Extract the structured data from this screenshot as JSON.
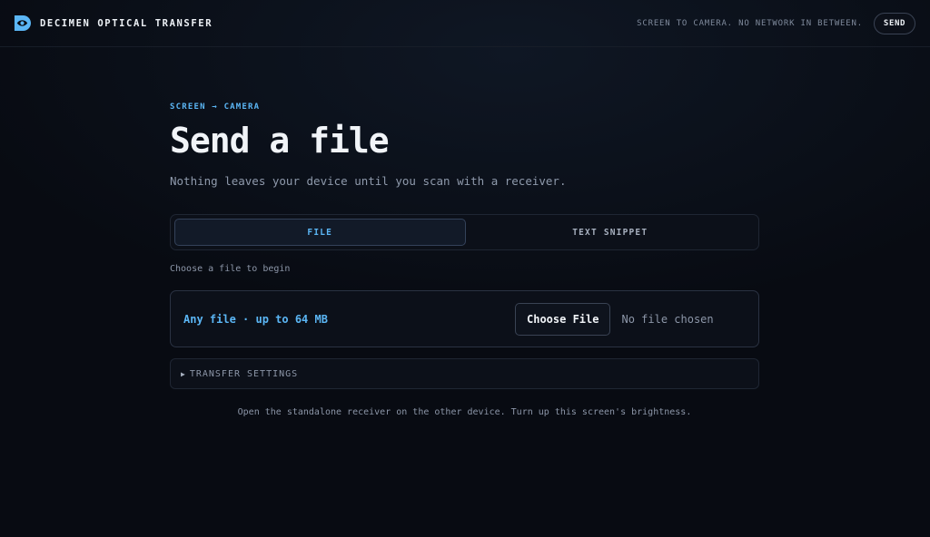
{
  "header": {
    "brand_name": "DECIMEN OPTICAL TRANSFER",
    "tagline": "SCREEN TO CAMERA. NO NETWORK IN BETWEEN.",
    "send_label": "SEND",
    "logo_icon": "eye-logo-icon"
  },
  "main": {
    "eyebrow": "SCREEN → CAMERA",
    "title": "Send a file",
    "subtitle": "Nothing leaves your device until you scan with a receiver.",
    "tabs": [
      {
        "label": "FILE",
        "active": true
      },
      {
        "label": "TEXT SNIPPET",
        "active": false
      }
    ],
    "hint": "Choose a file to begin",
    "dropzone": {
      "label": "Any file · up to 64 MB",
      "choose_button": "Choose File",
      "status": "No file chosen"
    },
    "settings": {
      "caret_icon": "triangle-right-icon",
      "label": "TRANSFER SETTINGS"
    },
    "footer_note": "Open the standalone receiver on the other device. Turn up this screen's brightness."
  },
  "colors": {
    "background": "#080b12",
    "accent": "#5bb6f5",
    "text_primary": "#f1f4f8",
    "text_muted": "#8c96a8"
  }
}
